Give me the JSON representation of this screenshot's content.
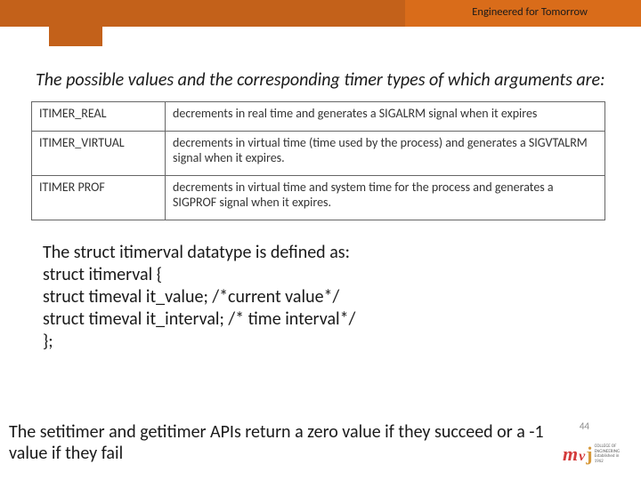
{
  "header": {
    "tagline": "Engineered for Tomorrow"
  },
  "intro": "The possible values and the corresponding timer types of which arguments are:",
  "table": {
    "rows": [
      {
        "key": "ITIMER_REAL",
        "desc": "decrements in real time and generates a SIGALRM signal when it expires"
      },
      {
        "key": "ITIMER_VIRTUAL",
        "desc": "decrements in virtual time (time used by the process) and generates a SIGVTALRM signal when it expires."
      },
      {
        "key": "ITIMER  PROF",
        "desc": "decrements in virtual time and system time for the process and generates a SIGPROF signal when it expires."
      }
    ]
  },
  "struct": {
    "line1": "The struct itimerval datatype is defined as:",
    "line2": " struct itimerval {",
    "line3": "struct timeval it_value; /*current value*/",
    "line4": "struct timeval it_interval; /* time interval*/",
    "line5": "};"
  },
  "footer": "The setitimer and getitimer APIs return a zero value if they succeed or a -1 value if they fail",
  "page_number": "44",
  "logo": {
    "m": "m",
    "v": "v",
    "j": "j",
    "sub1": "COLLEGE OF",
    "sub2": "ENGINEERING",
    "sub3": "Established in 1962"
  }
}
